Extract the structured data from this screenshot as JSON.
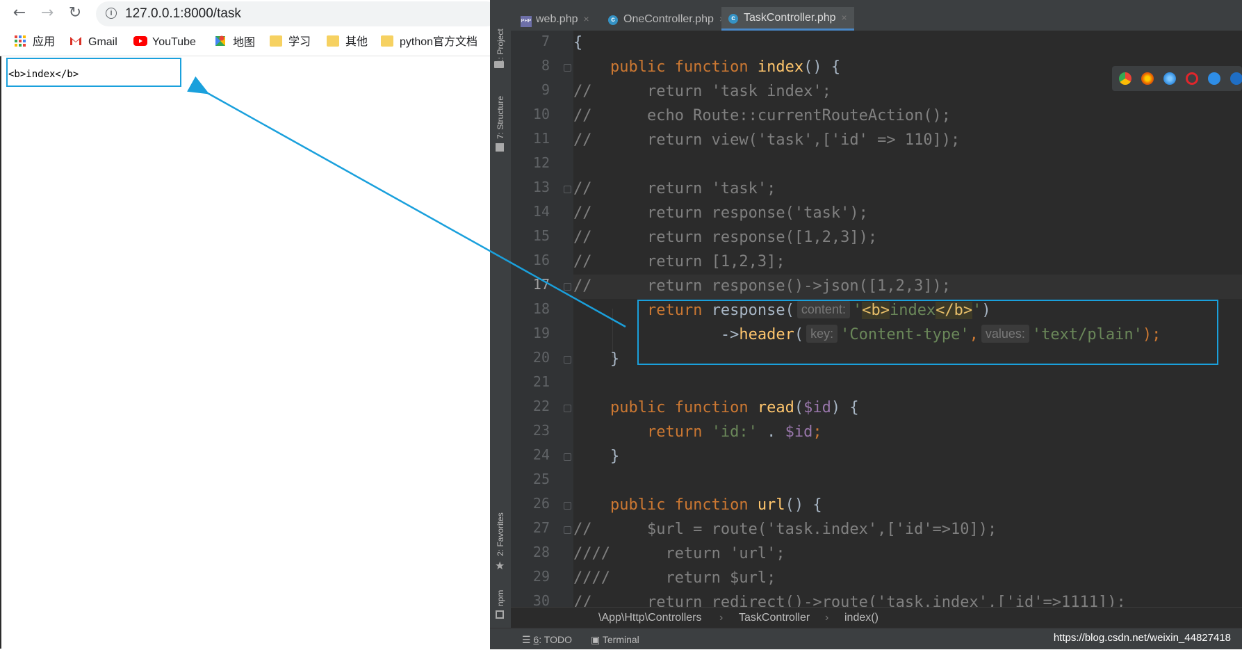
{
  "browser": {
    "nav": {
      "back": "←",
      "forward": "→",
      "reload": "↻"
    },
    "url": "127.0.0.1:8000/task",
    "bookmarks": [
      {
        "label": "应用",
        "icon": "apps-grid-icon"
      },
      {
        "label": "Gmail",
        "icon": "gmail-icon"
      },
      {
        "label": "YouTube",
        "icon": "youtube-icon"
      },
      {
        "label": "地图",
        "icon": "maps-icon"
      },
      {
        "label": "学习",
        "icon": "folder-icon"
      },
      {
        "label": "其他",
        "icon": "folder-icon"
      },
      {
        "label": "python官方文档",
        "icon": "folder-icon"
      }
    ],
    "page_text": "<b>index</b>"
  },
  "ide": {
    "side_tabs": {
      "project": "1: Project",
      "structure": "7: Structure",
      "favorites": "2: Favorites",
      "npm": "npm"
    },
    "tabs": [
      {
        "label": "web.php",
        "icon": "php-file-icon"
      },
      {
        "label": "OneController.php",
        "icon": "class-icon"
      },
      {
        "label": "TaskController.php",
        "icon": "class-icon",
        "active": true
      }
    ],
    "line_numbers": [
      "7",
      "8",
      "9",
      "10",
      "11",
      "12",
      "13",
      "14",
      "15",
      "16",
      "17",
      "18",
      "19",
      "20",
      "21",
      "22",
      "23",
      "24",
      "25",
      "26",
      "27",
      "28",
      "29",
      "30"
    ],
    "current_line": "17",
    "hints": {
      "content": "content:",
      "key": "key:",
      "values": "values:"
    },
    "breadcrumb": [
      "\\App\\Http\\Controllers",
      "TaskController",
      "index()"
    ],
    "breadcrumb_sep": "›",
    "status": {
      "todo_num": "6",
      "todo": ": TODO",
      "terminal": "Terminal"
    },
    "colors": {
      "keyword": "#cc7832",
      "function": "#ffc66d",
      "string": "#6a8759",
      "variable": "#9876aa",
      "comment": "#808080",
      "highlight": "#1aa0dc"
    }
  },
  "watermark": "https://blog.csdn.net/weixin_44827418"
}
